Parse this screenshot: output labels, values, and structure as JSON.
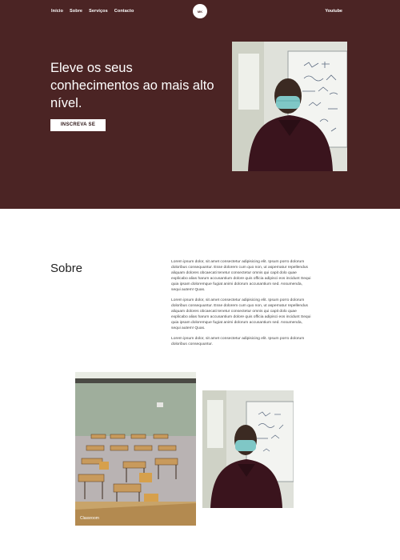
{
  "nav": {
    "items": [
      {
        "label": "Início"
      },
      {
        "label": "Sobre"
      },
      {
        "label": "Serviços"
      },
      {
        "label": "Contacto"
      }
    ],
    "logo_text": "MK",
    "youtube_label": "Youtube"
  },
  "hero": {
    "title": "Eleve os seus conhecimentos ao mais alto nível.",
    "cta_label": "INSCREVA SE"
  },
  "about": {
    "title": "Sobre",
    "paragraphs": [
      "Lorem ipsum dolor, sit amet consectetur adipisicing elit. Ipsum porro dolorum doloribus consequuntur. Esse dolorem cum quo non, ut aspernatur repellendus aliquam dolores obcaecati tenetur consectetur omnis qui capit dolo quae explicabo alias harum accusantium dolore quis officia adipisci eos incidunt Sequi quia ipsam doloremque fugiat animi dolorum accusantium sed. Assumenda, sequi autem! Quas.",
      "Lorem ipsum dolor, sit amet consectetur adipisicing elit. Ipsum porro dolorum doloribus consequuntur. Esse dolorem cum quo non, ut aspernatur repellendus aliquam dolores obcaecati tenetur consectetur omnis qui capit dolo quae explicabo alias harum accusantium dolore quis officia adipisci eos incidunt Sequi quia ipsam doloremque fugiat animi dolorum accusantium sed. Assumenda, sequi autem! Quas.",
      "Lorem ipsum dolor, sit amet consectetur adipisicing elit. Ipsum porro dolorum doloribus consequuntur."
    ]
  },
  "gallery": {
    "caption": "Classroom"
  },
  "colors": {
    "hero_bg": "#4b2424",
    "accent_text": "#ffffff"
  }
}
